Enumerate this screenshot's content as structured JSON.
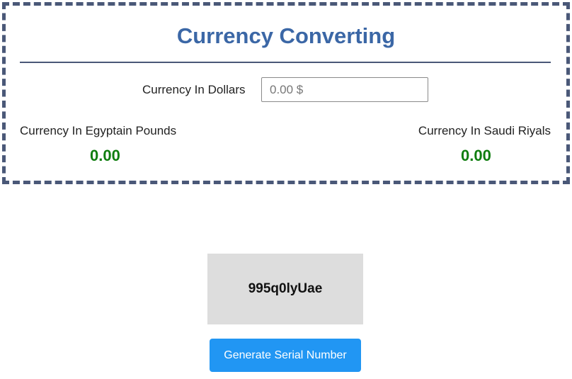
{
  "converter": {
    "title": "Currency Converting",
    "dollar_label": "Currency In Dollars",
    "dollar_placeholder": "0.00 $",
    "dollar_value": "",
    "egp_label": "Currency In Egyptain Pounds",
    "egp_value": "0.00",
    "sar_label": "Currency In Saudi Riyals",
    "sar_value": "0.00"
  },
  "serial": {
    "value": "995q0lyUae",
    "button_label": "Generate Serial Number"
  },
  "colors": {
    "title": "#3b67a6",
    "border": "#4a5878",
    "result_value": "#0f7d0f",
    "button": "#2196f3",
    "serial_box": "#dddddd"
  }
}
